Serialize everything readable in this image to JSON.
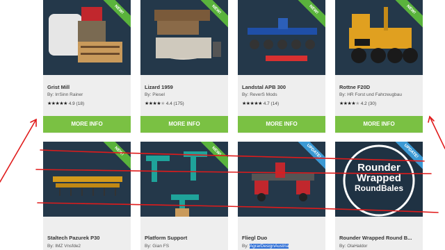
{
  "cards": [
    {
      "title": "Grist Mill",
      "author_prefix": "By: ",
      "author": "IrrSinn Rainer",
      "rating": "4.9 (18)",
      "stars": 5,
      "ribbon": "NEW!",
      "ribbon_type": "new",
      "button": "MORE INFO",
      "thumb": "mill"
    },
    {
      "title": "Lizard 1959",
      "author_prefix": "By: ",
      "author": "Piesel",
      "rating": "4.4 (175)",
      "stars": 4,
      "ribbon": "NEW!",
      "ribbon_type": "new",
      "button": "MORE INFO",
      "thumb": "truck"
    },
    {
      "title": "Landstal APB 300",
      "author_prefix": "By: ",
      "author": "ReverS Mods",
      "rating": "4.7 (14)",
      "stars": 5,
      "ribbon": "NEW!",
      "ribbon_type": "new",
      "button": "MORE INFO",
      "thumb": "cultivator"
    },
    {
      "title": "Rottne F20D",
      "author_prefix": "By: ",
      "author": "HR Forst und Fahrzeugbau",
      "rating": "4.2 (30)",
      "stars": 4,
      "ribbon": "NEW!",
      "ribbon_type": "new",
      "button": "MORE INFO",
      "thumb": "forwarder"
    },
    {
      "title": "Staltech Pazurek P30",
      "author_prefix": "By: ",
      "author": "IMZ Vnsfde2",
      "ribbon": "NEW!",
      "ribbon_type": "new",
      "thumb": "harrow"
    },
    {
      "title": "Platform Support",
      "author_prefix": "By: ",
      "author": "Gian FS",
      "ribbon": "NEW!",
      "ribbon_type": "new",
      "thumb": "supports"
    },
    {
      "title": "Fliegl Duo",
      "author_prefix": "By: ",
      "author": "AgrarDesignAustria",
      "ribbon": "UPDATE!",
      "ribbon_type": "update",
      "thumb": "fliegl",
      "author_highlight": true
    },
    {
      "title": "Rounder Wrapped Round B...",
      "author_prefix": "By: ",
      "author": "OlaHaldor",
      "ribbon": "UPDATE!",
      "ribbon_type": "update",
      "thumb": "rounder",
      "logo_lines": [
        "Rounder",
        "Wrapped",
        "RoundBales"
      ]
    }
  ],
  "colors": {
    "button": "#7ac143",
    "new_ribbon": "#5ab33c",
    "update_ribbon": "#3b99d4",
    "annotation": "#e01b1b"
  }
}
